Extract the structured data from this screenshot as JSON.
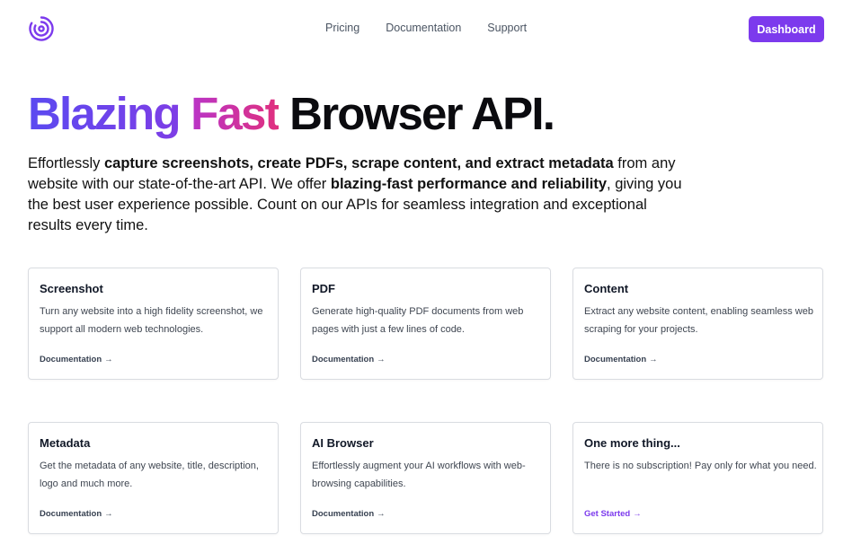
{
  "nav": {
    "logo_icon": "concentric-circles-logo",
    "links": [
      "Pricing",
      "Documentation",
      "Support"
    ],
    "dashboard_label": "Dashboard",
    "accent_color": "#7c3aed"
  },
  "hero": {
    "title_part1": "Blazing",
    "title_part2": "Fast",
    "title_part3": "Browser API.",
    "desc": {
      "t1": "Effortlessly ",
      "b1": "capture screenshots, create PDFs, scrape content, and extract metadata",
      "t2": " from any website with our state-of-the-art API. We offer ",
      "b2": "blazing-fast performance and reliability",
      "t3": ", giving you the best user experience possible. Count on our APIs for seamless integration and exceptional results every time."
    }
  },
  "cards": [
    {
      "title": "Screenshot",
      "desc": "Turn any website into a high fidelity screenshot, we support all modern web technologies.",
      "link": "Documentation"
    },
    {
      "title": "PDF",
      "desc": "Generate high-quality PDF documents from web pages with just a few lines of code.",
      "link": "Documentation"
    },
    {
      "title": "Content",
      "desc": "Extract any website content, enabling seamless web scraping for your projects.",
      "link": "Documentation"
    },
    {
      "title": "Metadata",
      "desc": "Get the metadata of any website, title, description, logo and much more.",
      "link": "Documentation"
    },
    {
      "title": "AI Browser",
      "desc": "Effortlessly augment your AI workflows with web-browsing capabilities.",
      "link": "Documentation"
    },
    {
      "title": "One more thing...",
      "desc": "There is no subscription! Pay only for what you need.",
      "link": "Get Started"
    }
  ],
  "link_arrow": "→"
}
